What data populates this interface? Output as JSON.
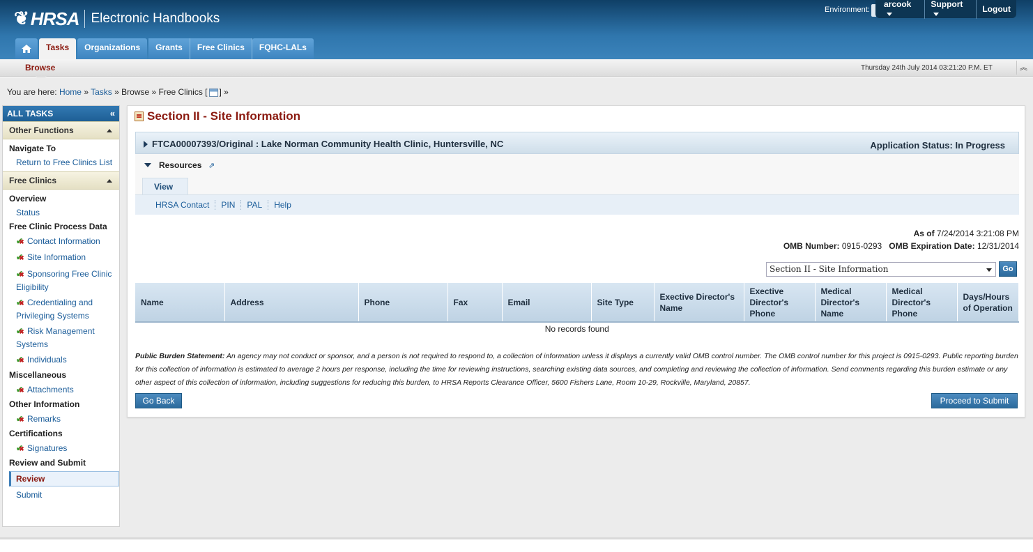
{
  "header": {
    "logo_text": "HRSA",
    "app_title": "Electronic Handbooks",
    "environment_label": "Environment:",
    "user_menu": [
      "arcook",
      "Support",
      "Logout"
    ]
  },
  "nav_tabs": [
    {
      "label": "Tasks",
      "active": true
    },
    {
      "label": "Organizations"
    },
    {
      "label": "Grants"
    },
    {
      "label": "Free Clinics"
    },
    {
      "label": "FQHC-LALs"
    }
  ],
  "subbar": {
    "browse_label": "Browse",
    "datetime": "Thursday 24th July 2014 03:21:20 P.M. ET"
  },
  "breadcrumb": {
    "prefix": "You are here:",
    "items": [
      "Home",
      "Tasks",
      "Browse",
      "Free Clinics ["
    ]
  },
  "sidebar": {
    "title": "ALL TASKS",
    "groups": [
      {
        "label": "Other Functions"
      },
      {
        "label": "Free Clinics"
      }
    ],
    "navigate_to": "Navigate To",
    "return_link": "Return to Free Clinics List",
    "overview": "Overview",
    "status": "Status",
    "process_data": "Free Clinic Process Data",
    "process_items": [
      "Contact Information",
      "Site Information",
      "Sponsoring Free Clinic Eligibility",
      "Credentialing and Privileging Systems",
      "Risk Management Systems",
      "Individuals"
    ],
    "misc": "Miscellaneous",
    "attachments": "Attachments",
    "other_info": "Other Information",
    "remarks": "Remarks",
    "certifications": "Certifications",
    "signatures": "Signatures",
    "review_submit": "Review and Submit",
    "review": "Review",
    "submit": "Submit"
  },
  "main": {
    "page_title": "Section II - Site Information",
    "application": "FTCA00007393/Original : Lake Norman Community Health Clinic, Huntersville, NC",
    "app_status": "Application Status: In Progress",
    "resources_label": "Resources",
    "view_tab": "View",
    "resource_links": [
      "HRSA Contact",
      "PIN",
      "PAL",
      "Help"
    ],
    "as_of_label": "As of",
    "as_of_value": "7/24/2014 3:21:08 PM",
    "omb_number_label": "OMB Number:",
    "omb_number": "0915-0293",
    "omb_expiration_label": "OMB Expiration Date:",
    "omb_expiration": "12/31/2014",
    "section_select": "Section II - Site Information",
    "go_label": "Go",
    "table_headers": [
      "Name",
      "Address",
      "Phone",
      "Fax",
      "Email",
      "Site Type",
      "Exective Director's Name",
      "Exective Director's Phone",
      "Medical Director's Name",
      "Medical Director's Phone",
      "Days/Hours of Operation"
    ],
    "empty_message": "No records found",
    "burden_title": "Public Burden Statement:",
    "burden_text": "An agency may not conduct or sponsor, and a person is not required to respond to, a collection of information unless it displays a currently valid OMB control number. The OMB control number for this project is 0915-0293. Public reporting burden for this collection of information is estimated to average 2 hours per response, including the time for reviewing instructions, searching existing data sources, and completing and reviewing the collection of information. Send comments regarding this burden estimate or any other aspect of this collection of information, including suggestions for reducing this burden, to HRSA Reports Clearance Officer, 5600 Fishers Lane, Room 10-29, Rockville, Maryland, 20857.",
    "go_back": "Go Back",
    "proceed": "Proceed to Submit"
  },
  "colors": {
    "header_blue": "#2f76ad",
    "title_red": "#8b1a10",
    "link_blue": "#1a5c99"
  }
}
